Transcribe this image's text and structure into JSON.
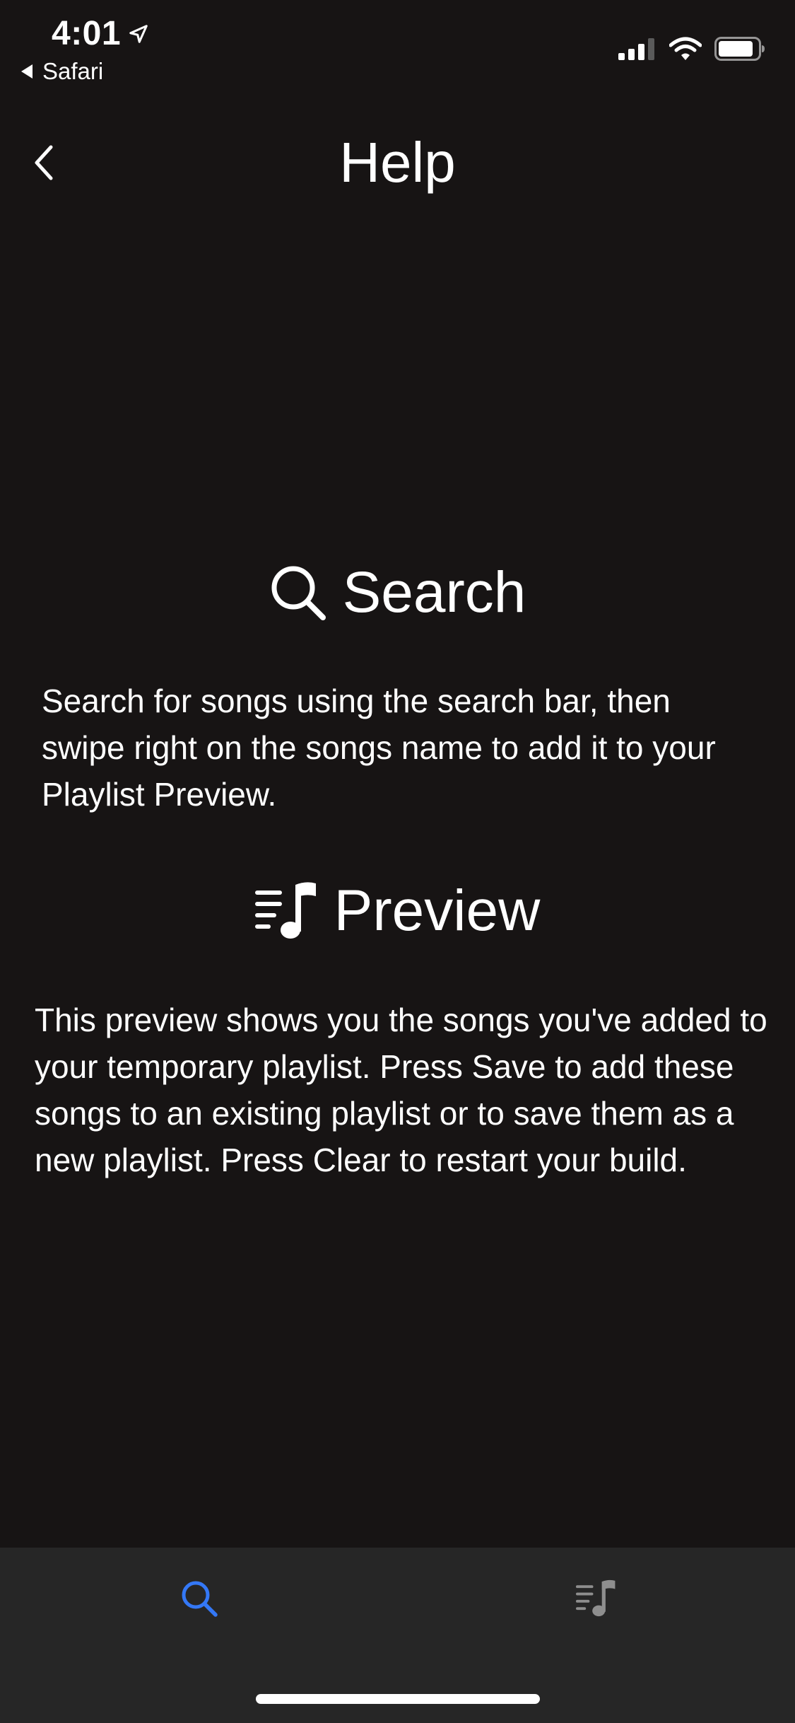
{
  "status_bar": {
    "time": "4:01",
    "back_app": "Safari",
    "icons": [
      "location-arrow-icon",
      "cellular-signal-icon",
      "wifi-icon",
      "battery-icon"
    ]
  },
  "nav": {
    "title": "Help",
    "back_icon": "chevron-left-icon"
  },
  "sections": {
    "search": {
      "icon": "search-icon",
      "title": "Search",
      "body": "Search for songs using the search bar, then swipe right on the songs name to add it to your Playlist Preview."
    },
    "preview": {
      "icon": "playlist-icon",
      "title": "Preview",
      "body": "This preview shows you the songs you've added to your temporary playlist. Press Save to add these songs to an existing playlist or to save them as a new playlist. Press Clear to restart your build."
    }
  },
  "tab_bar": {
    "tabs": [
      {
        "name": "search",
        "icon": "search-icon",
        "selected": true
      },
      {
        "name": "preview",
        "icon": "playlist-icon",
        "selected": false
      }
    ]
  },
  "colors": {
    "background": "#171414",
    "tab_bar": "#262626",
    "accent": "#3478F6",
    "inactive_icon": "#8E8E8E",
    "text": "#FFFFFF"
  }
}
